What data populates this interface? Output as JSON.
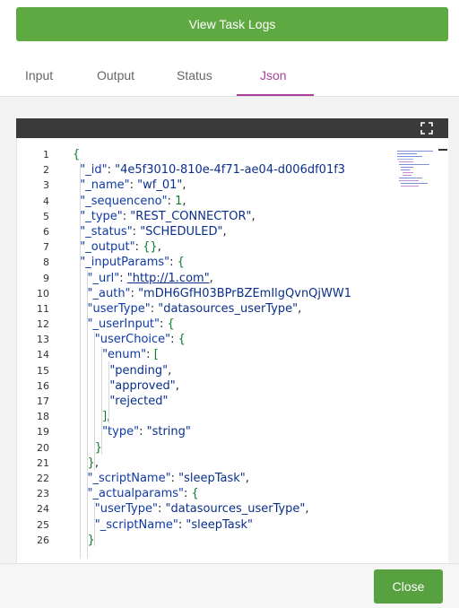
{
  "header": {
    "view_logs_label": "View Task Logs"
  },
  "tabs": [
    {
      "label": "Input",
      "active": false
    },
    {
      "label": "Output",
      "active": false
    },
    {
      "label": "Status",
      "active": false
    },
    {
      "label": "Json",
      "active": true
    }
  ],
  "editor": {
    "line_numbers": [
      "1",
      "2",
      "3",
      "4",
      "5",
      "6",
      "7",
      "8",
      "9",
      "10",
      "11",
      "12",
      "13",
      "14",
      "15",
      "16",
      "17",
      "18",
      "19",
      "20",
      "21",
      "22",
      "23",
      "24",
      "25",
      "26"
    ],
    "lines": [
      "{",
      "  \"_id\": \"4e5f3010-810e-4f71-ae04-d006df01f3",
      "  \"_name\": \"wf_01\",",
      "  \"_sequenceno\": 1,",
      "  \"_type\": \"REST_CONNECTOR\",",
      "  \"_status\": \"SCHEDULED\",",
      "  \"_output\": {},",
      "  \"_inputParams\": {",
      "    \"_url\": \"http://1.com\",",
      "    \"_auth\": \"mDH6GfH03BPrBZEmIlgQvnQjWW1",
      "    \"userType\": \"datasources_userType\",",
      "    \"_userInput\": {",
      "      \"userChoice\": {",
      "        \"enum\": [",
      "          \"pending\",",
      "          \"approved\",",
      "          \"rejected\"",
      "        ],",
      "        \"type\": \"string\"",
      "      }",
      "    },",
      "    \"_scriptName\": \"sleepTask\",",
      "    \"_actualparams\": {",
      "      \"userType\": \"datasources_userType\",",
      "      \"_scriptName\": \"sleepTask\"",
      "    }"
    ]
  },
  "footer": {
    "close_label": "Close"
  },
  "colors": {
    "accent_green": "#5fa942",
    "tab_active": "#a8429a",
    "editor_header": "#3a3a3a"
  },
  "icons": {
    "expand": "expand-icon"
  }
}
